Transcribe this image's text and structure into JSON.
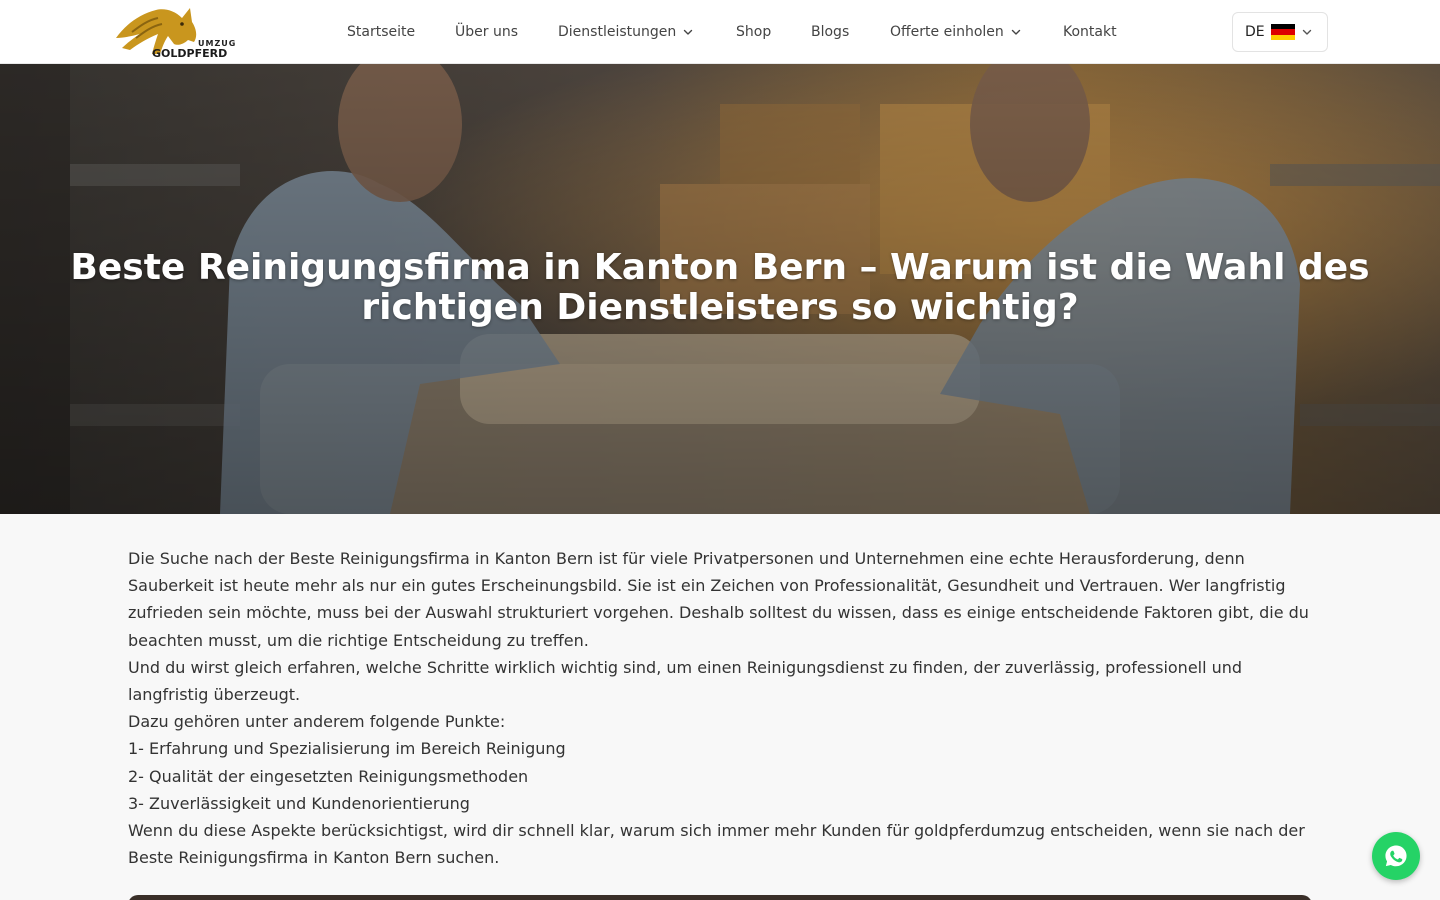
{
  "brand": {
    "logo_top": "UMZUG",
    "logo_bottom": "GOLDPFERD",
    "gold": "#c9961e"
  },
  "nav": {
    "items": [
      {
        "label": "Startseite"
      },
      {
        "label": "Über uns"
      },
      {
        "label": "Dienstleistungen",
        "dropdown": true
      },
      {
        "label": "Shop"
      },
      {
        "label": "Blogs"
      },
      {
        "label": "Offerte einholen",
        "dropdown": true
      },
      {
        "label": "Kontakt"
      }
    ]
  },
  "language": {
    "code": "DE",
    "flag_icon": "germany-flag-icon",
    "flag_colors": [
      "#000000",
      "#dd0000",
      "#ffce00"
    ]
  },
  "hero": {
    "title": "Beste Reinigungsfirma in Kanton Bern – Warum ist die Wahl des richtigen Dienstleisters so wichtig?"
  },
  "content": {
    "paragraphs": [
      "Die Suche nach der Beste Reinigungsfirma in Kanton Bern ist für viele Privatpersonen und Unternehmen eine echte Herausforderung, denn Sauberkeit ist heute mehr als nur ein gutes Erscheinungsbild. Sie ist ein Zeichen von Professionalität, Gesundheit und Vertrauen. Wer langfristig zufrieden sein möchte, muss bei der Auswahl strukturiert vorgehen. Deshalb solltest du wissen, dass es einige entscheidende Faktoren gibt, die du beachten musst, um die richtige Entscheidung zu treffen.",
      "Und du wirst gleich erfahren, welche Schritte wirklich wichtig sind, um einen Reinigungsdienst zu finden, der zuverlässig, professionell und langfristig überzeugt.",
      "Dazu gehören unter anderem folgende Punkte:",
      "1- Erfahrung und Spezialisierung im Bereich Reinigung",
      "2- Qualität der eingesetzten Reinigungsmethoden",
      "3- Zuverlässigkeit und Kundenorientierung",
      "Wenn du diese Aspekte berücksichtigst, wird dir schnell klar, warum sich immer mehr Kunden für goldpferdumzug entscheiden, wenn sie nach der Beste Reinigungsfirma in Kanton Bern suchen."
    ]
  },
  "whatsapp": {
    "icon": "whatsapp-icon",
    "color": "#25d366"
  }
}
